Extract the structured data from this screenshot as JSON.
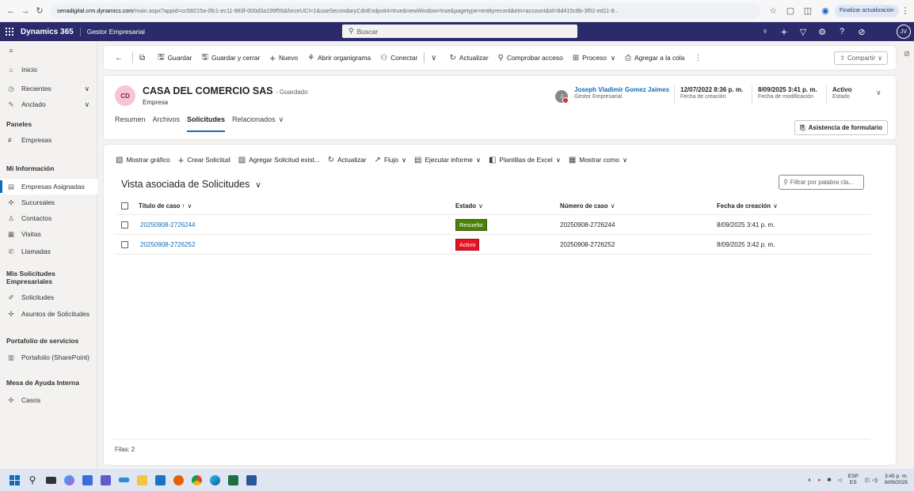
{
  "browser": {
    "url_host": "senadigital.crm.dynamics.com",
    "url_path": "/main.aspx?appid=cc58215a-0fc1-ec11-983f-000d3a199f55&forceUCI=1&useSecondaryCdnEndpoint=true&newWindow=true&pagetype=entityrecord&etn=account&id=8d415c8b-3f02-ed11-8...",
    "update_button": "Finalizar actualización"
  },
  "header": {
    "product": "Dynamics 365",
    "app_name": "Gestor Empresarial",
    "search_placeholder": "Buscar",
    "user_initials": "JV"
  },
  "sidebar": {
    "items": [
      {
        "label": "Inicio",
        "icon": "home-icon"
      },
      {
        "label": "Recientes",
        "icon": "clock-icon"
      },
      {
        "label": "Anclado",
        "icon": "pin-icon"
      }
    ],
    "sections": [
      {
        "title": "Paneles",
        "items": [
          {
            "label": "Empresas",
            "icon": "dashboard-icon"
          }
        ]
      },
      {
        "title": "Mi Información",
        "items": [
          {
            "label": "Empresas Asignadas",
            "icon": "building-icon"
          },
          {
            "label": "Sucursales",
            "icon": "puzzle-icon"
          },
          {
            "label": "Contactos",
            "icon": "person-icon"
          },
          {
            "label": "Visitas",
            "icon": "calendar-icon"
          },
          {
            "label": "Llamadas",
            "icon": "phone-icon"
          }
        ]
      },
      {
        "title": "Mis Solicitudes Empresariales",
        "items": [
          {
            "label": "Solicitudes",
            "icon": "pen-icon"
          },
          {
            "label": "Asuntos de Solicitudes",
            "icon": "puzzle-icon"
          }
        ]
      },
      {
        "title": "Portafolio de servicios",
        "items": [
          {
            "label": "Portafolio (SharePoint)",
            "icon": "library-icon"
          }
        ]
      },
      {
        "title": "Mesa de Ayuda Interna",
        "items": [
          {
            "label": "Casos",
            "icon": "puzzle-icon"
          }
        ]
      }
    ]
  },
  "commandbar": {
    "save": "Guardar",
    "save_close": "Guardar y cerrar",
    "new": "Nuevo",
    "org_chart": "Abrir organigrama",
    "connect": "Conectar",
    "refresh": "Actualizar",
    "check_access": "Comprobar acceso",
    "process": "Proceso",
    "queue": "Agregar a la cola",
    "share": "Compartir"
  },
  "record": {
    "initials": "CD",
    "title": "CASA DEL COMERCIO SAS",
    "state": "- Guardado",
    "entity": "Empresa",
    "owner_initial": "J",
    "owner_name": "Joseph Vladimir Gomez Jaimes",
    "owner_role": "Gestor Empresarial",
    "created_value": "12/07/2022 8:36 p. m.",
    "created_label": "Fecha de creación",
    "modified_value": "8/09/2025 3:41 p. m.",
    "modified_label": "Fecha de modificación",
    "status_value": "Activo",
    "status_label": "Estado",
    "tabs": [
      "Resumen",
      "Archivos",
      "Solicitudes",
      "Relacionados"
    ],
    "active_tab": "Solicitudes",
    "form_assist": "Asistencia de formulario"
  },
  "subgrid": {
    "commands": [
      "Mostrar gráfico",
      "Crear Solicitud",
      "Agregar Solicitud exist...",
      "Actualizar",
      "Flujo",
      "Ejecutar informe",
      "Plantillas de Excel",
      "Mostrar como"
    ],
    "view_title": "Vista asociada de Solicitudes",
    "filter_placeholder": "Filtrar por palabra cla...",
    "columns": [
      "Título de caso ↑",
      "Estado",
      "Número de caso",
      "Fecha de creación"
    ],
    "rows": [
      {
        "title": "20250908-2726244",
        "status": "Resuelto",
        "status_color": "#498205",
        "number": "20250908-2726244",
        "created": "8/09/2025 3:41 p. m."
      },
      {
        "title": "20250908-2726252",
        "status": "Activo",
        "status_color": "#e81123",
        "number": "20250908-2726252",
        "created": "8/09/2025 3:42 p. m."
      }
    ],
    "footer": "Filas: 2"
  },
  "taskbar": {
    "lang_top": "ESP",
    "lang_bottom": "ES",
    "time": "3:45 p. m.",
    "date": "8/09/2025"
  },
  "colors": {
    "brand_header": "#2b2b6b",
    "accent": "#0f6cbd"
  }
}
